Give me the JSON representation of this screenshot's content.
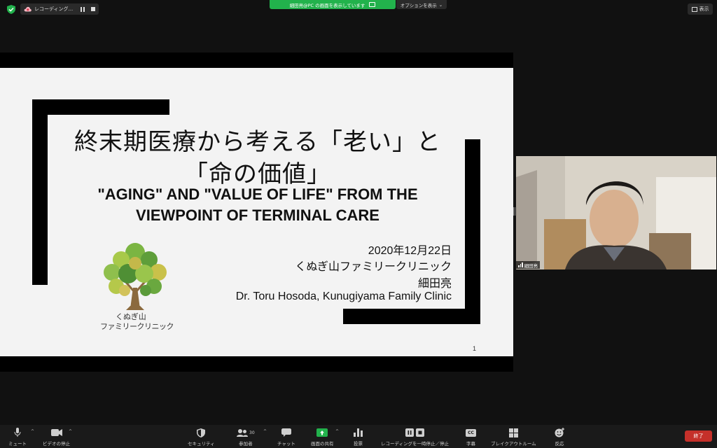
{
  "top_bar": {
    "recording_label": "レコーディング...",
    "share_banner_text": "細田亮@PC の画面を表示しています",
    "options_label": "オプションを表示",
    "view_label": "表示",
    "accent_color": "#22b24c"
  },
  "slide": {
    "title_jp_line1": "終末期医療から考える「老い」と",
    "title_jp_line2": "「命の価値」",
    "title_en_line1": "\"AGING\" AND \"VALUE OF LIFE\" FROM THE",
    "title_en_line2": "VIEWPOINT OF TERMINAL CARE",
    "date": "2020年12月22日",
    "clinic_jp": "くぬぎ山ファミリークリニック",
    "presenter_jp": "細田亮",
    "presenter_en": "Dr. Toru Hosoda, Kunugiyama Family Clinic",
    "logo_line1": "くぬぎ山",
    "logo_line2": "ファミリークリニック",
    "page_number": "1"
  },
  "participant": {
    "name": "細田亮"
  },
  "toolbar": {
    "mute": "ミュート",
    "stop_video": "ビデオの停止",
    "security": "セキュリティ",
    "participants": "参加者",
    "participant_count": "30",
    "chat": "チャット",
    "share_screen": "画面の共有",
    "poll": "投票",
    "recording": "レコーディングを一時停止／停止",
    "captions": "字幕",
    "captions_badge": "CC",
    "breakout": "ブレイクアウトルーム",
    "reactions": "反応",
    "end": "終了",
    "end_color": "#c5302a"
  }
}
